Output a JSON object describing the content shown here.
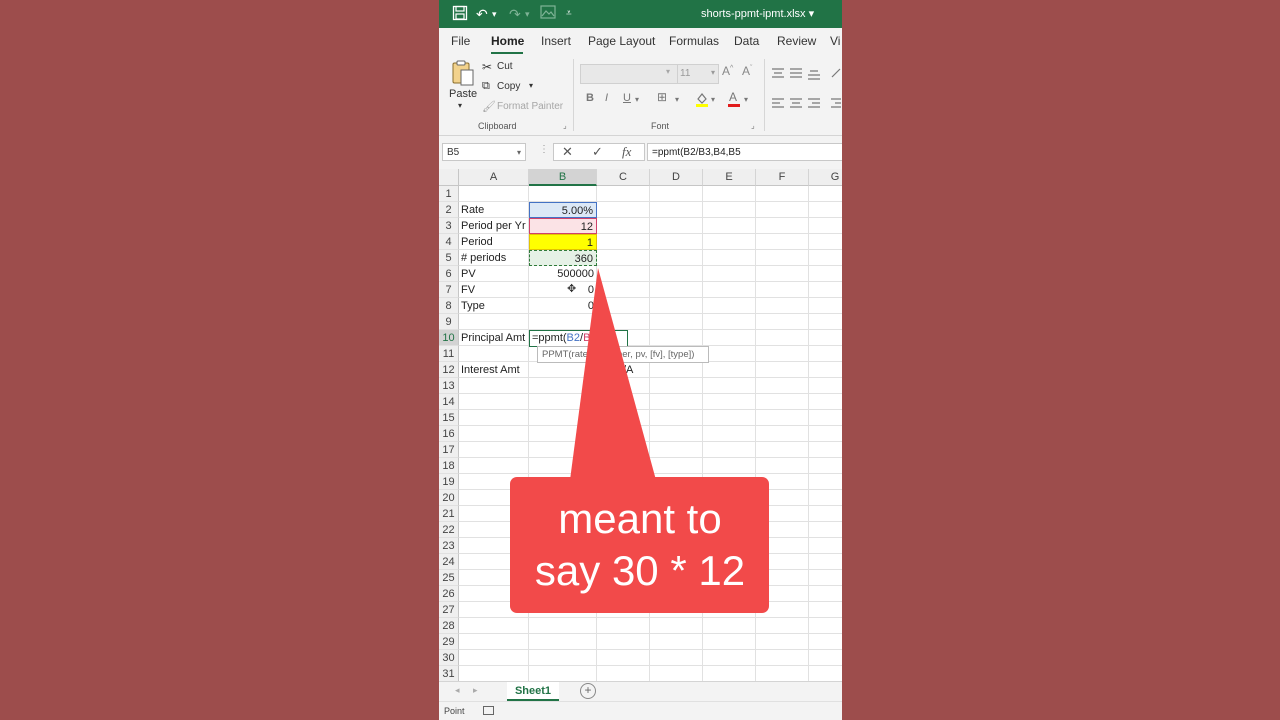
{
  "window": {
    "filename": "shorts-ppmt-ipmt.xlsx",
    "filename_caret": "▾"
  },
  "colors": {
    "accent": "#217346",
    "background": "#9d4d4c",
    "callout": "#f24a4a"
  },
  "ribbon": {
    "tabs": [
      "File",
      "Home",
      "Insert",
      "Page Layout",
      "Formulas",
      "Data",
      "Review",
      "Vi"
    ],
    "active_tab": "Home",
    "clipboard": {
      "paste": "Paste",
      "cut": "Cut",
      "copy": "Copy",
      "format_painter": "Format Painter",
      "group_label": "Clipboard"
    },
    "font": {
      "size": "11",
      "bold": "B",
      "italic": "I",
      "underline": "U",
      "group_label": "Font"
    }
  },
  "formula_bar": {
    "name_box": "B5",
    "formula": "=ppmt(B2/B3,B4,B5",
    "fx": "fx"
  },
  "grid": {
    "columns": [
      "A",
      "B",
      "C",
      "D",
      "E",
      "F",
      "G"
    ],
    "selected_column": "B",
    "rows": [
      "1",
      "2",
      "3",
      "4",
      "5",
      "6",
      "7",
      "8",
      "9",
      "10",
      "11",
      "12",
      "13",
      "14",
      "15",
      "16",
      "17",
      "18",
      "19",
      "20",
      "21",
      "22",
      "23",
      "24",
      "25",
      "26",
      "27",
      "28",
      "29",
      "30",
      "31"
    ],
    "selected_row": "10",
    "cells": {
      "A2": "Rate",
      "B2": "5.00%",
      "A3": "Period per Yr",
      "B3": "12",
      "A4": "Period",
      "B4": "1",
      "A5": "# periods",
      "B5": "360",
      "A6": "PV",
      "B6": "500000",
      "A7": "FV",
      "B7": "0",
      "A8": "Type",
      "B8": "0",
      "A10": "Principal Amt",
      "A12": "Interest Amt",
      "C12": "/A"
    },
    "edit": {
      "prefix": "=ppmt(",
      "ref1": "B2",
      "sep1": "/",
      "ref2": "B3",
      "sep2": ",",
      "ref3": "B5"
    },
    "tooltip": "PPMT(rate, per, nper, pv, [fv], [type])"
  },
  "sheets": {
    "tabs": [
      "Sheet1"
    ],
    "active": "Sheet1"
  },
  "status": {
    "mode": "Point"
  },
  "callout": {
    "line1": "meant to",
    "line2": "say 30 * 12"
  }
}
